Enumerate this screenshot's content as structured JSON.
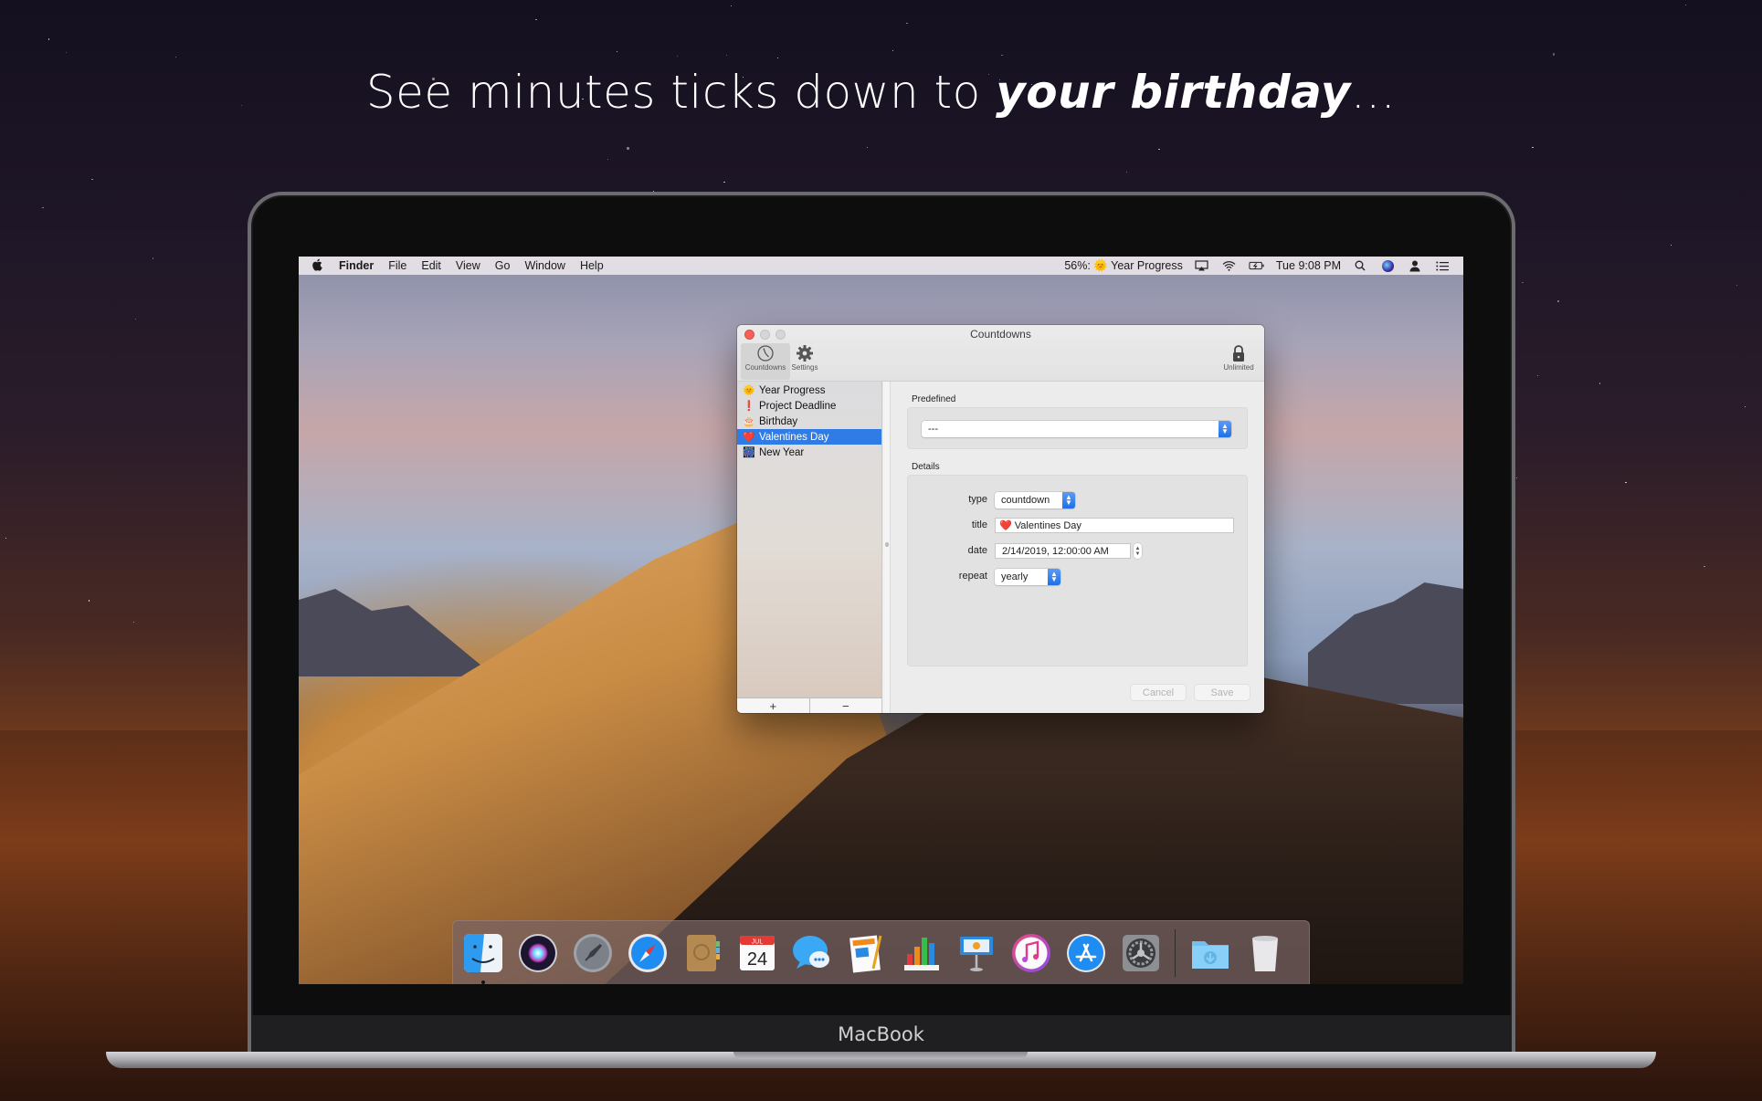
{
  "promo": {
    "headline_plain": "See minutes ticks down to ",
    "headline_emphasis": "your birthday",
    "headline_suffix": "..."
  },
  "device": {
    "label": "MacBook"
  },
  "menubar": {
    "apple_icon": "apple-logo",
    "app_name": "Finder",
    "menus": [
      "File",
      "Edit",
      "View",
      "Go",
      "Window",
      "Help"
    ],
    "status_item": {
      "percent": "56%:",
      "emoji": "🌞",
      "label": "Year Progress"
    },
    "clock": "Tue 9:08 PM",
    "icons": [
      "airplay-icon",
      "wifi-icon",
      "battery-charging-icon",
      "spotlight-search-icon",
      "siri-icon",
      "user-icon",
      "notification-center-icon"
    ]
  },
  "window": {
    "title": "Countdowns",
    "toolbar": {
      "countdowns_label": "Countdowns",
      "settings_label": "Settings",
      "unlimited_label": "Unlimited"
    },
    "sidebar": {
      "items": [
        {
          "emoji": "🌞",
          "label": "Year Progress",
          "selected": false
        },
        {
          "emoji": "❗",
          "label": "Project Deadline",
          "selected": false
        },
        {
          "emoji": "🎂",
          "label": "Birthday",
          "selected": false
        },
        {
          "emoji": "❤️",
          "label": "Valentines Day",
          "selected": true
        },
        {
          "emoji": "🎆",
          "label": "New Year",
          "selected": false
        }
      ],
      "add_label": "+",
      "remove_label": "−"
    },
    "predefined": {
      "section_label": "Predefined",
      "selected_value": "---"
    },
    "details": {
      "section_label": "Details",
      "type_label": "type",
      "type_value": "countdown",
      "title_label": "title",
      "title_value": "❤️ Valentines Day",
      "date_label": "date",
      "date_value": "2/14/2019, 12:00:00 AM",
      "repeat_label": "repeat",
      "repeat_value": "yearly"
    },
    "buttons": {
      "cancel": "Cancel",
      "save": "Save"
    }
  },
  "dock": {
    "apps": [
      "Finder",
      "Siri",
      "Launchpad",
      "Safari",
      "Contacts",
      "Calendar",
      "Messages",
      "Pages",
      "Numbers",
      "Keynote",
      "iTunes",
      "App Store",
      "System Preferences"
    ],
    "calendar_month": "JUL",
    "calendar_day": "24",
    "stacks": [
      "Downloads",
      "Trash"
    ]
  }
}
